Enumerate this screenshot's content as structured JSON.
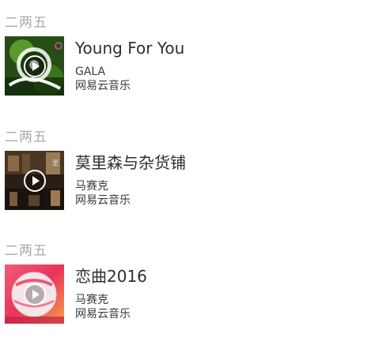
{
  "items": [
    {
      "day": "二两五",
      "title": "Young For You",
      "artist": "GALA",
      "source": "网易云音乐",
      "cover_icon": "play-icon",
      "cover_colors": {
        "primary": "#1d3a12",
        "accent": "#6fb83a"
      }
    },
    {
      "day": "二两五",
      "title": "莫里森与杂货铺",
      "artist": "马赛克",
      "source": "网易云音乐",
      "cover_icon": "play-icon",
      "cover_colors": {
        "primary": "#2a1e16",
        "accent": "#b89a6e"
      }
    },
    {
      "day": "二两五",
      "title": "恋曲2016",
      "artist": "马赛克",
      "source": "网易云音乐",
      "cover_icon": "play-icon",
      "cover_colors": {
        "primary": "#e8365a",
        "accent": "#f7a04a"
      }
    }
  ]
}
